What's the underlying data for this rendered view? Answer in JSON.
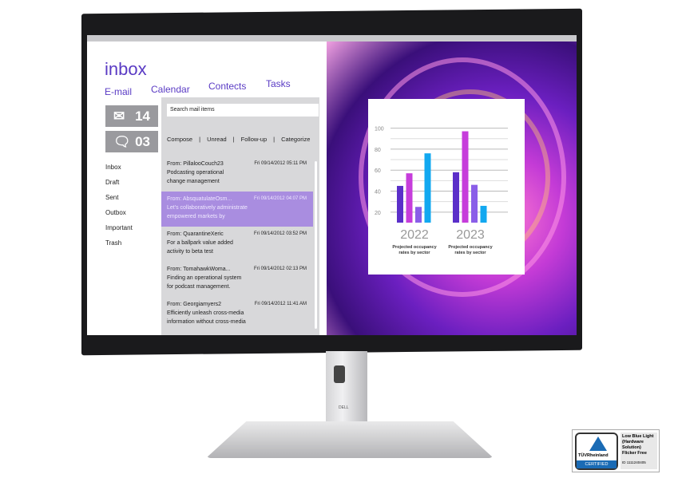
{
  "mail_app": {
    "title": "inbox",
    "nav": [
      "E-mail",
      "Calendar",
      "Contects",
      "Tasks"
    ],
    "counters": [
      {
        "icon": "envelope-icon",
        "value": "14"
      },
      {
        "icon": "chat-bubble-icon",
        "value": "03"
      }
    ],
    "search_placeholder": "Search mail items",
    "actions": [
      "Compose",
      "|",
      "Unread",
      "|",
      "Follow-up",
      "|",
      "Categorize"
    ],
    "folders": [
      "Inbox",
      "Draft",
      "Sent",
      "Outbox",
      "Important",
      "Trash"
    ],
    "messages": [
      {
        "from": "From: PillalooCouch23",
        "date": "Fri 09/14/2012 05:11 PM",
        "preview": [
          "Podcasting operational",
          "change management"
        ],
        "selected": false
      },
      {
        "from": "From: AbsquatulateOsm...",
        "date": "Fri 09/14/2012 04:07 PM",
        "preview": [
          "Let's collaboratively administrate",
          "empowered markets by"
        ],
        "selected": true
      },
      {
        "from": "From: QuarantineXeric",
        "date": "Fri 09/14/2012 03:52 PM",
        "preview": [
          "For a ballpark value added",
          "activity to beta test"
        ],
        "selected": false
      },
      {
        "from": "From: TomahawkWoma...",
        "date": "Fri 09/14/2012 02:13 PM",
        "preview": [
          "Finding an operational system",
          "for podcast management."
        ],
        "selected": false
      },
      {
        "from": "From: Georgiamyers2",
        "date": "Fri 09/14/2012 11:41 AM",
        "preview": [
          "Efficiently unleash cross-media",
          "information without cross-media"
        ],
        "selected": false
      }
    ],
    "selected_color": "#a98de0",
    "accent": "#5a3bc4"
  },
  "chart_data": {
    "type": "bar",
    "categories": [
      "2022",
      "2023"
    ],
    "category_captions": [
      "Projected occupancy rates by sector",
      "Projected occupancy rates by sector"
    ],
    "series": [
      {
        "values": [
          45,
          58
        ],
        "color": "#5b2fc9"
      },
      {
        "values": [
          57,
          97
        ],
        "color": "#c63ddb"
      },
      {
        "values": [
          25,
          46
        ],
        "color": "#8a5ee8"
      },
      {
        "values": [
          76,
          26
        ],
        "color": "#12a8f0"
      }
    ],
    "yticks": [
      20,
      40,
      60,
      80,
      100
    ],
    "ylim": [
      10,
      105
    ],
    "grid": true
  },
  "stand_logo": "DELL",
  "badge": {
    "brand": "TÜVRheinland",
    "certified": "CERTIFIED",
    "text": [
      "Low Blue Light",
      "(Hardware",
      "Solution)",
      "Flicker Free"
    ],
    "id": "ID 1111240405"
  }
}
